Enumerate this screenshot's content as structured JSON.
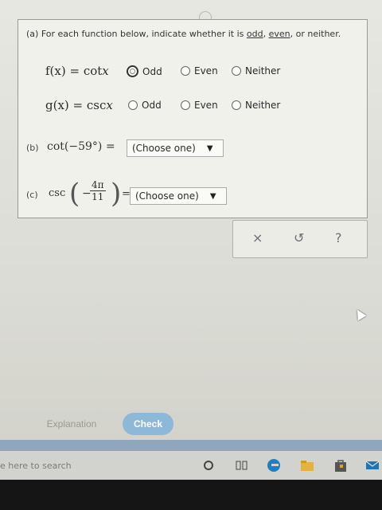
{
  "part_a": {
    "prefix": "(a) For each function below, indicate whether it is ",
    "w_odd": "odd",
    "sep1": ", ",
    "w_even": "even",
    "sep2": ", or neither."
  },
  "rows": [
    {
      "name": "f",
      "lhs": "f(x) = cot",
      "var": "x",
      "options": [
        "Odd",
        "Even",
        "Neither"
      ],
      "selected": "Odd"
    },
    {
      "name": "g",
      "lhs": "g(x) = csc",
      "var": "x",
      "options": [
        "Odd",
        "Even",
        "Neither"
      ],
      "selected": null
    }
  ],
  "part_b": {
    "label": "(b)",
    "expr": "cot(−59°) =",
    "dropdown": "(Choose one)"
  },
  "part_c": {
    "label": "(c)",
    "fn": "csc",
    "sign": "−",
    "numerator": "4π",
    "denominator": "11",
    "eq": "=",
    "dropdown": "(Choose one)"
  },
  "tools": {
    "close": "×",
    "undo": "↺",
    "help": "?"
  },
  "buttons": {
    "explanation": "Explanation",
    "check": "Check"
  },
  "taskbar": {
    "search_text": "e here to search"
  },
  "colors": {
    "check_button": "#8db8d8",
    "blue_bar": "#8fa6bd"
  }
}
